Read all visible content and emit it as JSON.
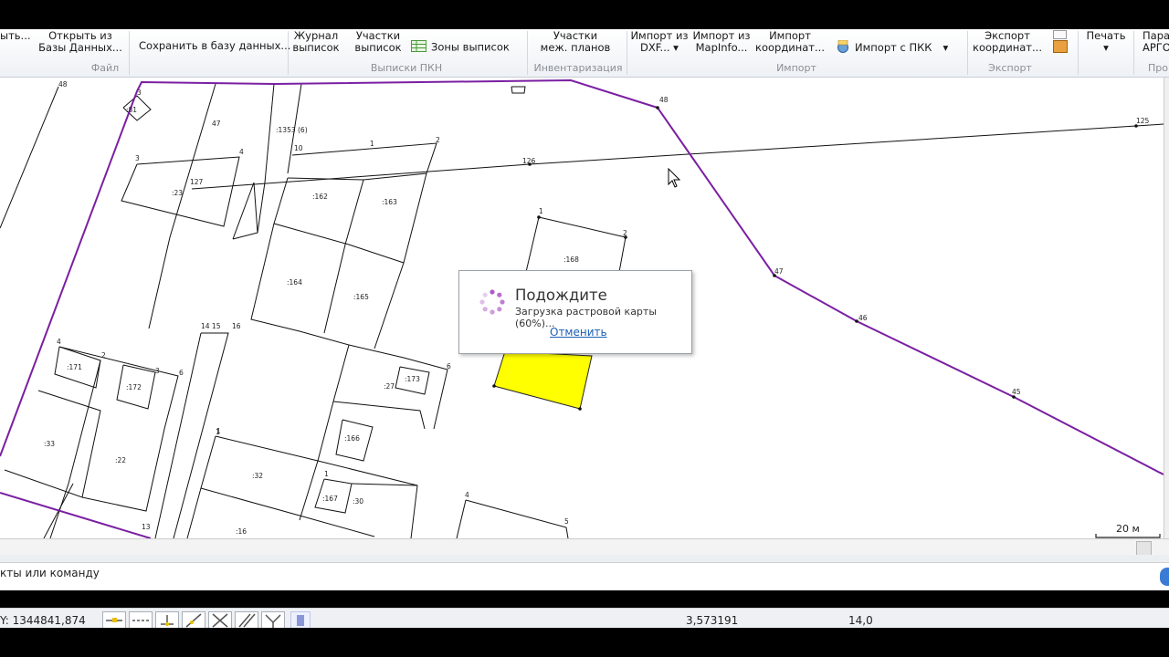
{
  "ribbon": {
    "file": {
      "group": "Файл",
      "open_partial": "ыть...",
      "open_db_l1": "Открыть из",
      "open_db_l2": "Базы Данных...",
      "save_db": "Сохранить в базу данных..."
    },
    "pkn": {
      "group": "Выписки ПКН",
      "journal_l1": "Журнал",
      "journal_l2": "выписок",
      "plots_l1": "Участки",
      "plots_l2": "выписок",
      "zones": "Зоны выписок"
    },
    "inventory": {
      "group": "Инвентаризация",
      "plots_l1": "Участки",
      "plots_l2": "меж. планов"
    },
    "import": {
      "group": "Импорт",
      "dxf_l1": "Импорт из",
      "dxf_l2": "DXF...",
      "mapinfo_l1": "Импорт из",
      "mapinfo_l2": "MapInfo...",
      "coords_l1": "Импорт",
      "coords_l2": "координат...",
      "pkk": "Импорт с ПКК"
    },
    "export": {
      "group": "Экспорт",
      "coords_l1": "Экспорт",
      "coords_l2": "координат..."
    },
    "print": {
      "label": "Печать"
    },
    "params": {
      "l1": "Пара",
      "l2": "АРГО",
      "group": "Про"
    }
  },
  "dialog": {
    "title": "Подождите",
    "message": "Загрузка растровой карты (60%)...",
    "cancel": "Отменить",
    "progress_percent": 60
  },
  "map": {
    "scale_label": "20 м",
    "labels": [
      {
        "t": "48"
      },
      {
        "t": "3"
      },
      {
        "t": ":81"
      },
      {
        "t": "47"
      },
      {
        "t": ":1353 (6)"
      },
      {
        "t": "10"
      },
      {
        "t": "1"
      },
      {
        "t": "2"
      },
      {
        "t": "3"
      },
      {
        "t": "4"
      },
      {
        "t": "127"
      },
      {
        "t": ":23"
      },
      {
        "t": "126"
      },
      {
        "t": "125"
      },
      {
        "t": ":162"
      },
      {
        "t": ":163"
      },
      {
        "t": "1"
      },
      {
        "t": "2"
      },
      {
        "t": ":168"
      },
      {
        "t": "48"
      },
      {
        "t": "47"
      },
      {
        "t": "46"
      },
      {
        "t": "45"
      },
      {
        "t": ":164"
      },
      {
        "t": ":165"
      },
      {
        "t": "14 15"
      },
      {
        "t": "16"
      },
      {
        "t": ":171"
      },
      {
        "t": ":172"
      },
      {
        "t": ":173"
      },
      {
        "t": ":33"
      },
      {
        "t": ":22"
      },
      {
        "t": ":166"
      },
      {
        "t": "1"
      },
      {
        "t": ":32"
      },
      {
        "t": ":167"
      },
      {
        "t": ":30"
      },
      {
        "t": ":16"
      },
      {
        "t": "4"
      },
      {
        "t": "5"
      },
      {
        "t": "6"
      },
      {
        "t": "2"
      },
      {
        "t": "3"
      },
      {
        "t": "4"
      },
      {
        "t": "1"
      },
      {
        "t": "13"
      },
      {
        "t": ":27"
      },
      {
        "t": "6"
      },
      {
        "t": "1"
      }
    ]
  },
  "command": {
    "prompt": "кты или команду"
  },
  "status": {
    "y_coord": "Y: 1344841,874",
    "value1": "3,573191",
    "value2": "14,0"
  },
  "colors": {
    "boundary": "#7a1fa2",
    "highlight": "#ffff00",
    "link": "#1b5fb5",
    "spinner": "#b05cc8"
  }
}
